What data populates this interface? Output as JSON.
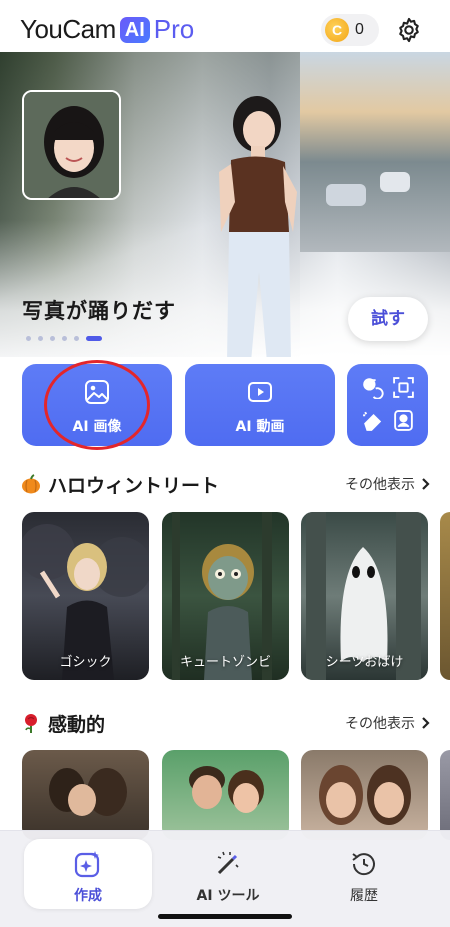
{
  "header": {
    "logo_text": "YouCam",
    "logo_ai": "AI",
    "logo_pro": "Pro",
    "coin_symbol": "C",
    "coin_count": "0",
    "settings_icon": "gear-icon"
  },
  "hero": {
    "title": "写真が踊りだす",
    "try_label": "試す",
    "carousel_total": 6,
    "carousel_active": 6
  },
  "features": {
    "image_label": "AI 画像",
    "video_label": "AI 動画",
    "image_icon": "image-icon",
    "video_icon": "video-play-icon",
    "tools_icons": [
      "face-swap-icon",
      "expand-icon",
      "eraser-icon",
      "portrait-icon"
    ]
  },
  "section_halloween": {
    "emoji": "pumpkin-icon",
    "title": "ハロウィントリート",
    "see_more": "その他表示",
    "cards": [
      {
        "label": "ゴシック"
      },
      {
        "label": "キュートゾンビ"
      },
      {
        "label": "シーツおばけ"
      }
    ]
  },
  "section_emotional": {
    "emoji": "rose-icon",
    "title": "感動的",
    "see_more": "その他表示"
  },
  "bottom_nav": {
    "create_label": "作成",
    "tools_label": "AI ツール",
    "history_label": "履歴"
  },
  "colors": {
    "accent": "#4f6cf1",
    "brand_purple": "#5b5cf0",
    "annotation_red": "#e3262b"
  }
}
